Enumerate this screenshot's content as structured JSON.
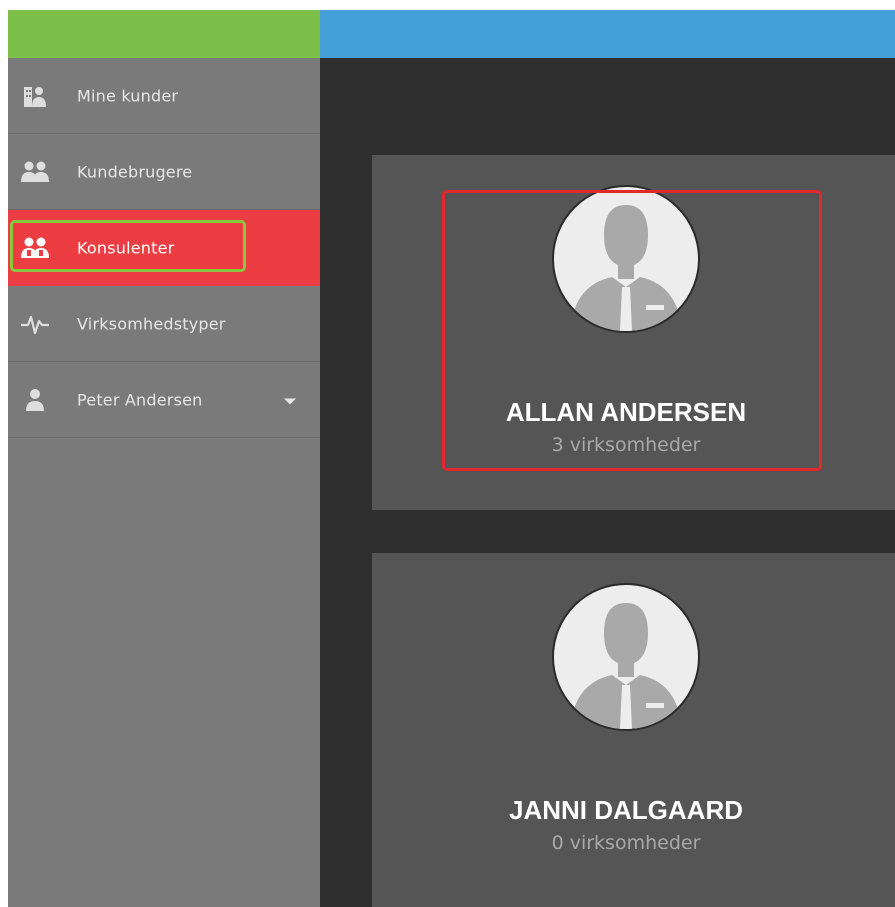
{
  "header": {
    "logo_color": "#7cc04a",
    "bar_color": "#45a0d8"
  },
  "sidebar": {
    "items": [
      {
        "label": "Mine kunder",
        "icon": "building-user-icon"
      },
      {
        "label": "Kundebrugere",
        "icon": "users-icon"
      },
      {
        "label": "Konsulenter",
        "icon": "consultants-icon",
        "active": true
      },
      {
        "label": "Virksomhedstyper",
        "icon": "pulse-icon"
      },
      {
        "label": "Peter Andersen",
        "icon": "user-icon",
        "has_dropdown": true
      }
    ],
    "active_color": "#ec3e42"
  },
  "consultants": [
    {
      "name": "ALLAN ANDERSEN",
      "count_label": "3 virksomheder"
    },
    {
      "name": "JANNI DALGAARD",
      "count_label": "0 virksomheder"
    }
  ]
}
